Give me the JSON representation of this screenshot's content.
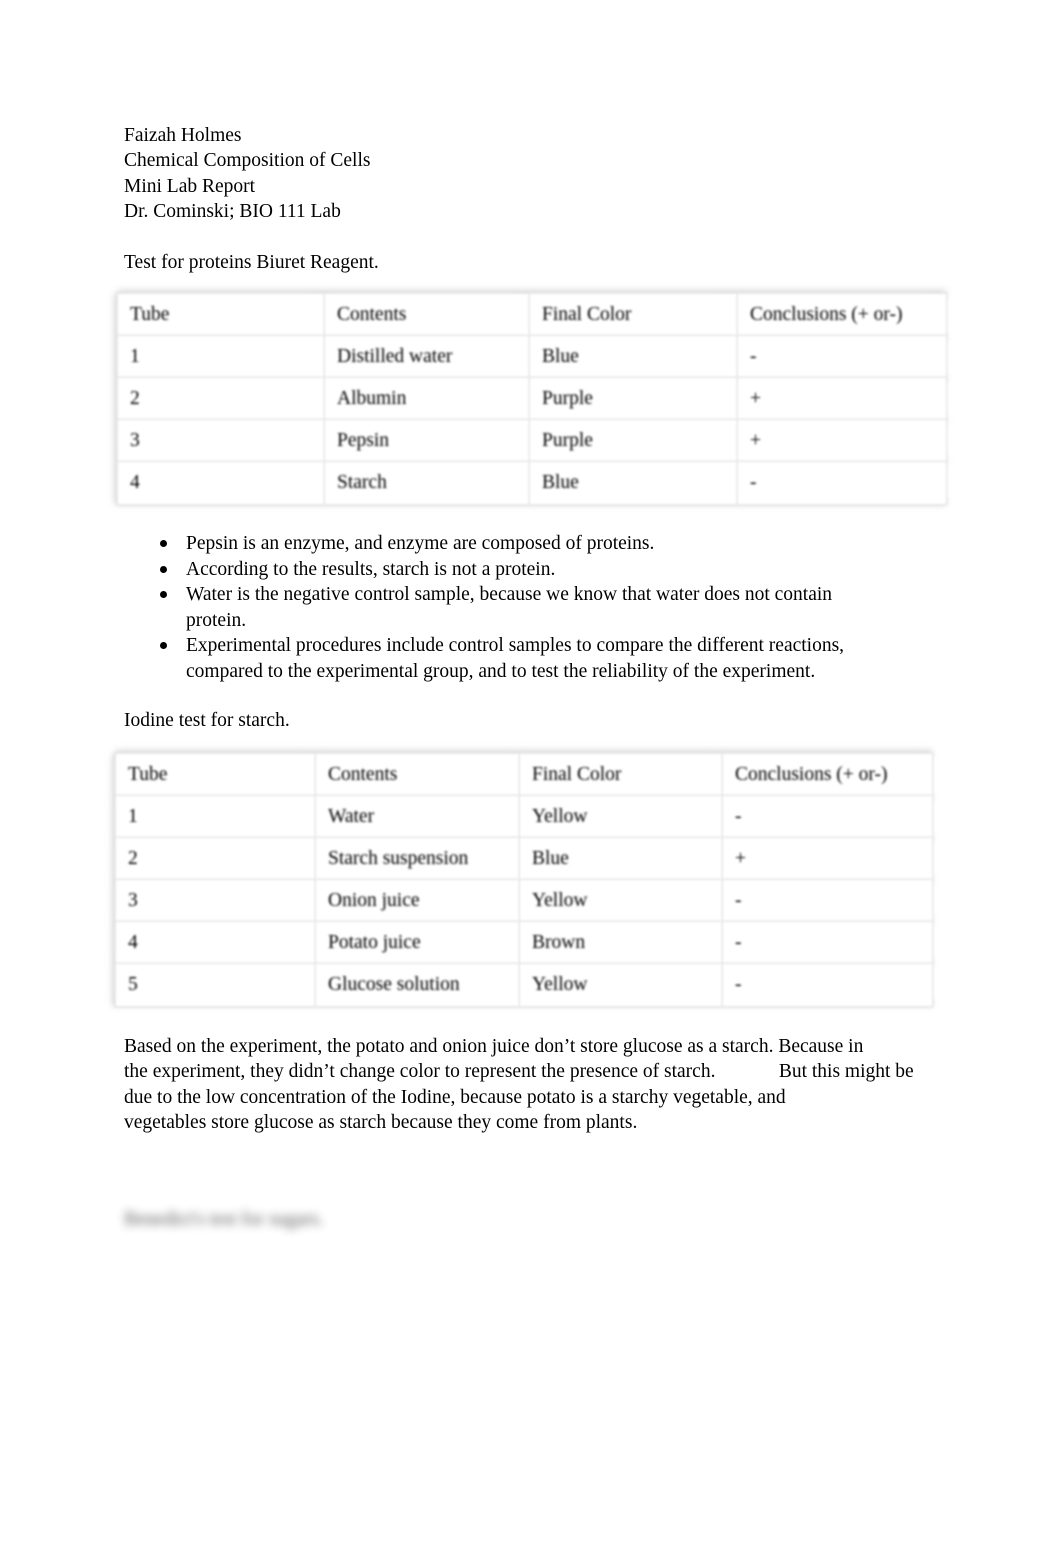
{
  "document": {
    "header_lines": [
      "Faizah Holmes",
      "Chemical Composition of Cells",
      "Mini Lab Report",
      "Dr. Cominski; BIO 111 Lab"
    ],
    "section_biuret_heading": "Test for proteins Biuret Reagent.",
    "section_iodine_heading": "Iodine test for starch.",
    "redacted_heading": "Benedict's test for sugars."
  },
  "table_biuret": {
    "columns": [
      "Tube",
      "Contents",
      "Final Color",
      "Conclusions (+ or-)"
    ],
    "rows": [
      [
        "1",
        "Distilled water",
        "Blue",
        "-"
      ],
      [
        "2",
        "Albumin",
        "Purple",
        "+"
      ],
      [
        "3",
        "Pepsin",
        "Purple",
        "+"
      ],
      [
        "4",
        "Starch",
        "Blue",
        "-"
      ]
    ]
  },
  "table_iodine": {
    "columns": [
      "Tube",
      "Contents",
      "Final Color",
      "Conclusions (+ or-)"
    ],
    "rows": [
      [
        "1",
        "Water",
        "Yellow",
        "-"
      ],
      [
        "2",
        "Starch suspension",
        "Blue",
        "+"
      ],
      [
        "3",
        "Onion juice",
        "Yellow",
        "-"
      ],
      [
        "4",
        "Potato juice",
        "Brown",
        "-"
      ],
      [
        "5",
        "Glucose solution",
        "Yellow",
        "-"
      ]
    ]
  },
  "bullets": [
    "Pepsin is an enzyme, and enzyme are composed of proteins.",
    "According to the results, starch is not a protein.",
    "Water is the negative control sample, because we know that water does not contain protein.",
    "Experimental procedures include control samples to compare the different reactions, compared to the experimental group, and to test the reliability of the experiment."
  ],
  "paragraph": {
    "lines": [
      "Based on the experiment, the potato and onion juice don’t store glucose as a starch. Because in",
      "the experiment, they didn’t change color to represent the presence of starch.             But this might be",
      "due to the low concentration of the Iodine, because potato is a starchy vegetable, and",
      "vegetables store glucose as starch because they come from plants."
    ]
  },
  "colors": {
    "page_background": "#ffffff",
    "text": "#000000",
    "table_grid": "#d9d9d9",
    "table_cell_background": "#ffffff"
  }
}
